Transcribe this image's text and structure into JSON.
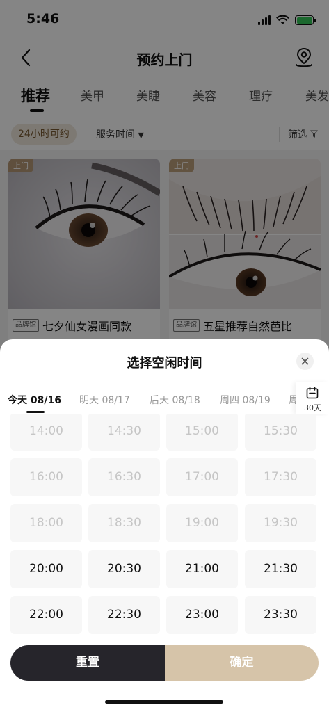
{
  "status_bar": {
    "time": "5:46"
  },
  "nav": {
    "title": "预约上门"
  },
  "category_tabs": [
    "推荐",
    "美甲",
    "美睫",
    "美容",
    "理疗",
    "美发"
  ],
  "filters": {
    "chip": "24小时可约",
    "service_time": "服务时间",
    "screen": "筛选"
  },
  "cards": [
    {
      "badge": "上门",
      "brand": "品牌馆",
      "title": "七夕仙女漫画同款"
    },
    {
      "badge": "上门",
      "brand": "品牌馆",
      "title": "五星推荐自然芭比"
    }
  ],
  "sheet": {
    "title": "选择空闲时间",
    "days": [
      "今天 08/16",
      "明天 08/17",
      "后天 08/18",
      "周四 08/19",
      "周"
    ],
    "calendar_label": "30天",
    "slots": [
      {
        "time": "14:00",
        "available": false
      },
      {
        "time": "14:30",
        "available": false
      },
      {
        "time": "15:00",
        "available": false
      },
      {
        "time": "15:30",
        "available": false
      },
      {
        "time": "16:00",
        "available": false
      },
      {
        "time": "16:30",
        "available": false
      },
      {
        "time": "17:00",
        "available": false
      },
      {
        "time": "17:30",
        "available": false
      },
      {
        "time": "18:00",
        "available": false
      },
      {
        "time": "18:30",
        "available": false
      },
      {
        "time": "19:00",
        "available": false
      },
      {
        "time": "19:30",
        "available": false
      },
      {
        "time": "20:00",
        "available": true
      },
      {
        "time": "20:30",
        "available": true
      },
      {
        "time": "21:00",
        "available": true
      },
      {
        "time": "21:30",
        "available": true
      },
      {
        "time": "22:00",
        "available": true
      },
      {
        "time": "22:30",
        "available": true
      },
      {
        "time": "23:00",
        "available": true
      },
      {
        "time": "23:30",
        "available": true
      }
    ],
    "reset_label": "重置",
    "confirm_label": "确定"
  },
  "colors": {
    "accent": "#d6c4a9",
    "dark_button": "#26252b",
    "chip_bg": "#f0e8dc"
  }
}
